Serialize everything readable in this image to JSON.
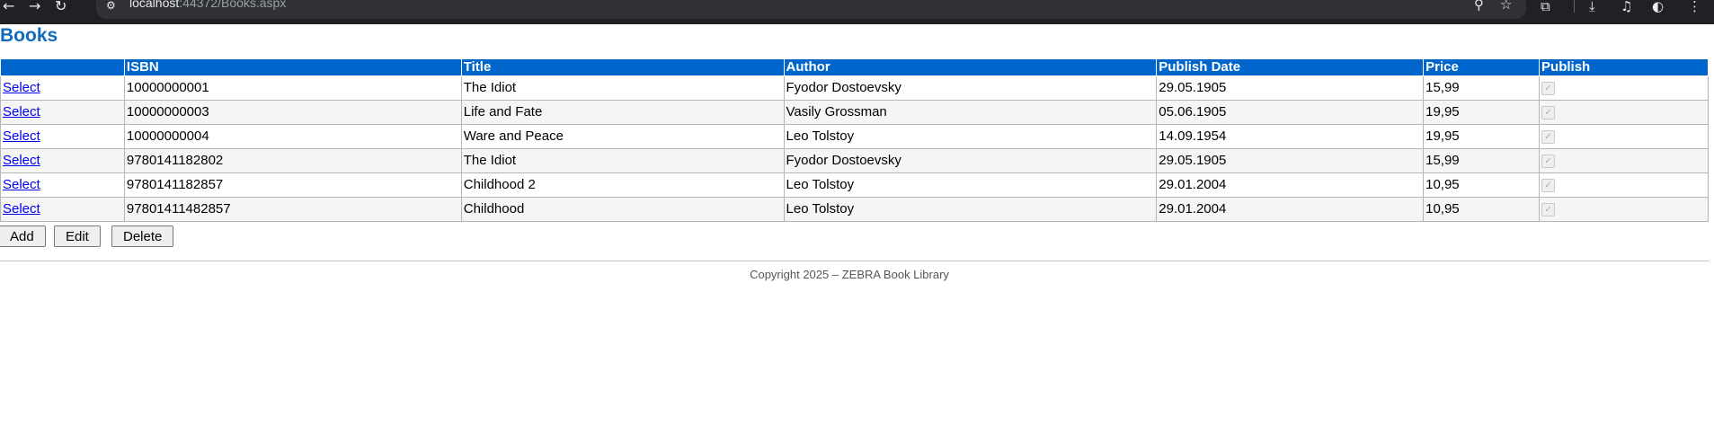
{
  "browser": {
    "url_host": "localhost",
    "url_rest": ":44372/Books.aspx"
  },
  "page": {
    "title": "Books"
  },
  "table": {
    "columns": [
      "",
      "ISBN",
      "Title",
      "Author",
      "Publish Date",
      "Price",
      "Publish"
    ],
    "rows": [
      {
        "select": "Select",
        "isbn": "10000000001",
        "title": "The Idiot",
        "author": "Fyodor Dostoevsky",
        "date": "29.05.1905",
        "price": "15,99",
        "publish": true
      },
      {
        "select": "Select",
        "isbn": "10000000003",
        "title": "Life and Fate",
        "author": "Vasily Grossman",
        "date": "05.06.1905",
        "price": "19,95",
        "publish": true
      },
      {
        "select": "Select",
        "isbn": "10000000004",
        "title": "Ware and Peace",
        "author": "Leo Tolstoy",
        "date": "14.09.1954",
        "price": "19,95",
        "publish": true
      },
      {
        "select": "Select",
        "isbn": "9780141182802",
        "title": "The Idiot",
        "author": "Fyodor Dostoevsky",
        "date": "29.05.1905",
        "price": "15,99",
        "publish": true
      },
      {
        "select": "Select",
        "isbn": "9780141182857",
        "title": "Childhood 2",
        "author": "Leo Tolstoy",
        "date": "29.01.2004",
        "price": "10,95",
        "publish": true
      },
      {
        "select": "Select",
        "isbn": "97801411482857",
        "title": "Childhood",
        "author": "Leo Tolstoy",
        "date": "29.01.2004",
        "price": "10,95",
        "publish": true
      }
    ]
  },
  "actions": {
    "add": "Add",
    "edit": "Edit",
    "delete": "Delete"
  },
  "footer": {
    "text": "Copyright 2025 – ZEBRA Book Library"
  },
  "colors": {
    "header_bg": "#0066cc",
    "title": "#0f6cbd",
    "browser_bar": "#202124"
  }
}
